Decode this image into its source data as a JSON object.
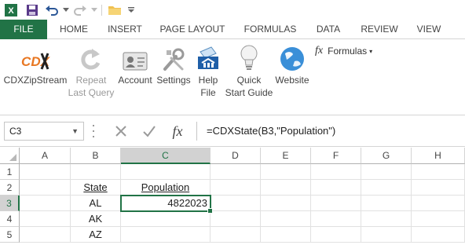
{
  "quick_access": {
    "app_icon": "excel-icon",
    "save_icon": "save-icon",
    "undo_icon": "undo-icon",
    "redo_icon": "redo-icon",
    "open_icon": "folder-icon",
    "customize_icon": "chevron-down-icon"
  },
  "tabs": [
    "FILE",
    "HOME",
    "INSERT",
    "PAGE LAYOUT",
    "FORMULAS",
    "DATA",
    "REVIEW",
    "VIEW"
  ],
  "ribbon": {
    "cdx_logo_text": "CDX",
    "zipstream": "CDXZipStream",
    "repeat_line1": "Repeat",
    "repeat_line2": "Last Query",
    "account": "Account",
    "settings": "Settings",
    "help_line1": "Help",
    "help_line2": "File",
    "quick_line1": "Quick",
    "quick_line2": "Start Guide",
    "website": "Website",
    "formulas_label": "Formulas",
    "fx_glyph": "fx"
  },
  "formula_bar": {
    "name_box": "C3",
    "formula": "=CDXState(B3,\"Population\")",
    "fx_label": "fx"
  },
  "columns": [
    "A",
    "B",
    "C",
    "D",
    "E",
    "F",
    "G",
    "H"
  ],
  "rows": [
    "1",
    "2",
    "3",
    "4",
    "5"
  ],
  "cells": {
    "B2": "State",
    "C2": "Population",
    "B3": "AL",
    "C3": "4822023",
    "B4": "AK",
    "B5": "AZ"
  },
  "colors": {
    "accent": "#217346"
  }
}
